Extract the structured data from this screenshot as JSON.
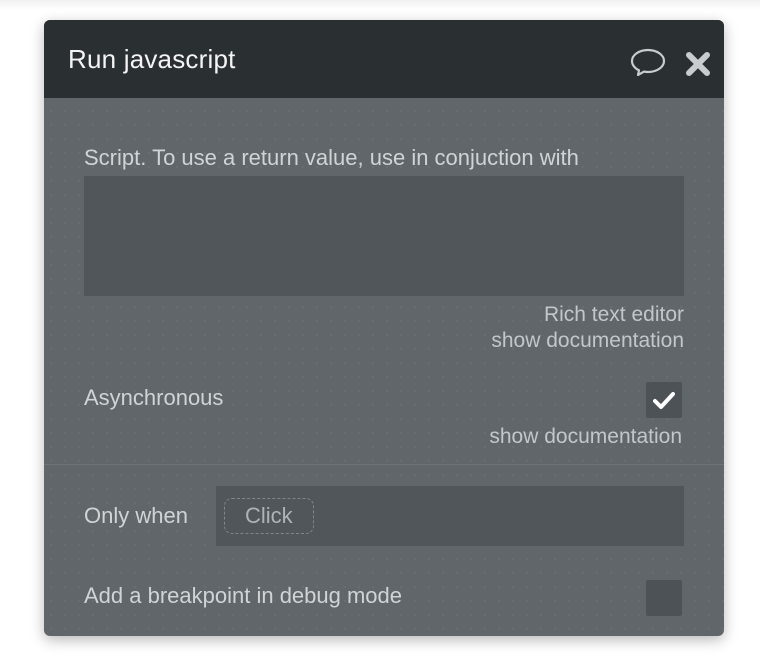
{
  "dialog": {
    "title": "Run javascript"
  },
  "header_icons": {
    "comment": "speech-bubble-icon",
    "close": "close-x-icon"
  },
  "script": {
    "label": "Script. To use a return value, use in conjuction with",
    "value": "",
    "rich_text_editor_link": "Rich text editor",
    "doc_link": "show documentation"
  },
  "asynchronous": {
    "label": "Asynchronous",
    "checked": true,
    "doc_link": "show documentation"
  },
  "only_when": {
    "label": "Only when",
    "chip": "Click"
  },
  "breakpoint": {
    "label": "Add a breakpoint in debug mode",
    "checked": false
  },
  "colors": {
    "header_bg": "#2a2f32",
    "panel_bg": "#60666a",
    "field_bg": "#50565a",
    "text": "#d0d4d6"
  }
}
